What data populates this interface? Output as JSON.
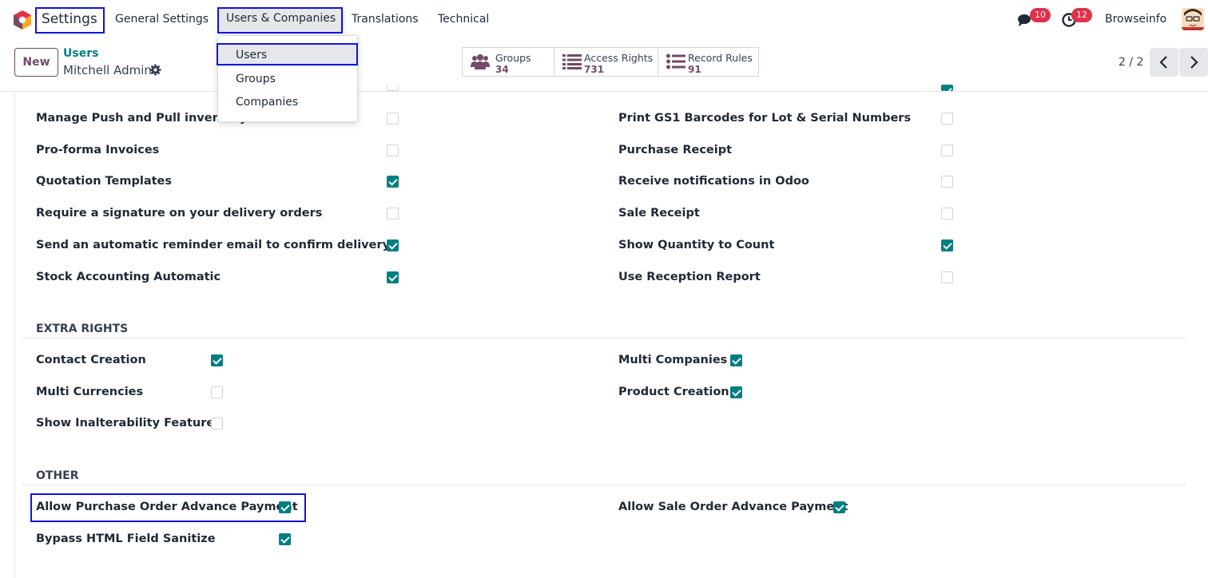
{
  "navbar": {
    "brand": "Settings",
    "menu": [
      "General Settings",
      "Users & Companies",
      "Translations",
      "Technical"
    ],
    "messages_count": "10",
    "activities_count": "12",
    "company": "Browseinfo"
  },
  "dropdown": {
    "items": [
      "Users",
      "Groups",
      "Companies"
    ]
  },
  "control": {
    "new_label": "New",
    "breadcrumb_parent": "Users",
    "breadcrumb_current": "Mitchell Admin",
    "smart_buttons": [
      {
        "label": "Groups",
        "count": "34"
      },
      {
        "label": "Access Rights",
        "count": "731"
      },
      {
        "label": "Record Rules",
        "count": "91"
      }
    ],
    "pager": "2 / 2"
  },
  "colors": {
    "accent": "#017e84",
    "brand": "#714b67",
    "highlight": "#1212e0",
    "badge": "#e2304a"
  },
  "technical": {
    "left": [
      {
        "label": "Manage Push and Pull inventory flows",
        "checked": false
      },
      {
        "label": "Pro-forma Invoices",
        "checked": false
      },
      {
        "label": "Quotation Templates",
        "checked": true
      },
      {
        "label": "Require a signature on your delivery orders",
        "checked": false
      },
      {
        "label": "Send an automatic reminder email to confirm delivery",
        "checked": true
      },
      {
        "label": "Stock Accounting Automatic",
        "checked": true
      }
    ],
    "right": [
      {
        "label": "Print GS1 Barcodes for Lot & Serial Numbers",
        "checked": false
      },
      {
        "label": "Purchase Receipt",
        "checked": false
      },
      {
        "label": "Receive notifications in Odoo",
        "checked": false
      },
      {
        "label": "Sale Receipt",
        "checked": false
      },
      {
        "label": "Show Quantity to Count",
        "checked": true
      },
      {
        "label": "Use Reception Report",
        "checked": false
      }
    ]
  },
  "extra_rights": {
    "title": "EXTRA RIGHTS",
    "left": [
      {
        "label": "Contact Creation",
        "checked": true
      },
      {
        "label": "Multi Currencies",
        "checked": false
      },
      {
        "label": "Show Inalterability Features",
        "checked": false
      }
    ],
    "right": [
      {
        "label": "Multi Companies",
        "checked": true
      },
      {
        "label": "Product Creation",
        "checked": true
      }
    ]
  },
  "other": {
    "title": "OTHER",
    "left": [
      {
        "label": "Allow Purchase Order Advance Payment",
        "checked": true
      },
      {
        "label": "Bypass HTML Field Sanitize",
        "checked": true
      }
    ],
    "right": [
      {
        "label": "Allow Sale Order Advance Payment",
        "checked": true
      }
    ]
  }
}
